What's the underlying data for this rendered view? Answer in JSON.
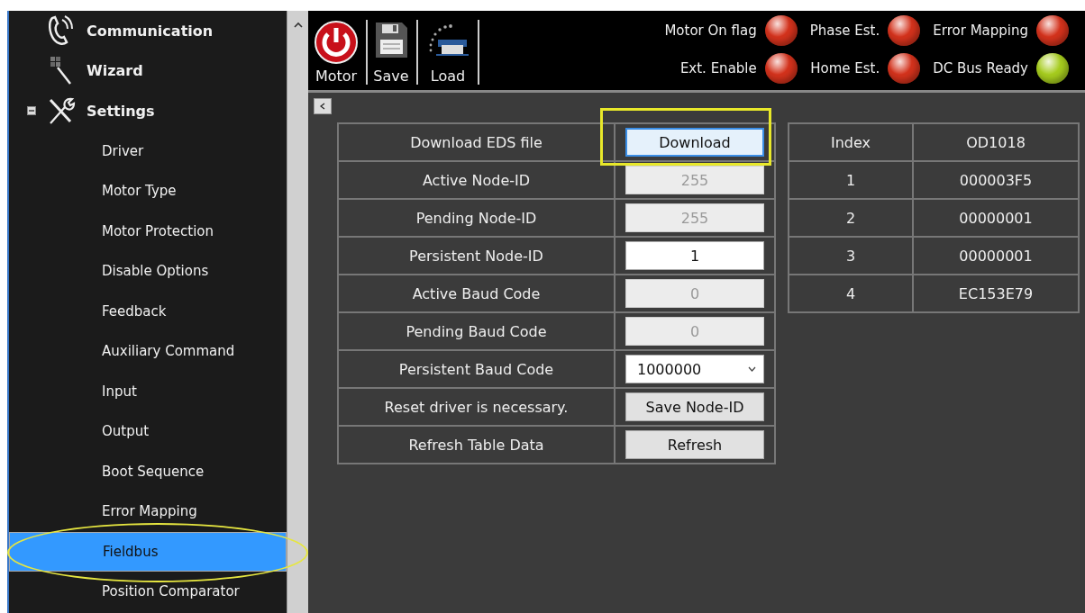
{
  "sidebar": {
    "items": [
      {
        "label": "Communication",
        "selected": false
      },
      {
        "label": "Wizard",
        "selected": false
      },
      {
        "label": "Settings",
        "selected": false,
        "expanded": true,
        "children": [
          {
            "label": "Driver",
            "selected": false
          },
          {
            "label": "Motor Type",
            "selected": false
          },
          {
            "label": "Motor Protection",
            "selected": false
          },
          {
            "label": "Disable Options",
            "selected": false
          },
          {
            "label": "Feedback",
            "selected": false
          },
          {
            "label": "Auxiliary Command",
            "selected": false
          },
          {
            "label": "Input",
            "selected": false
          },
          {
            "label": "Output",
            "selected": false
          },
          {
            "label": "Boot Sequence",
            "selected": false
          },
          {
            "label": "Error Mapping",
            "selected": false
          },
          {
            "label": "Fieldbus",
            "selected": true
          },
          {
            "label": "Position Comparator",
            "selected": false
          }
        ]
      }
    ]
  },
  "toolbar": {
    "buttons": [
      {
        "label": "Motor"
      },
      {
        "label": "Save"
      },
      {
        "label": "Load"
      }
    ],
    "indicators": [
      {
        "label": "Motor On flag",
        "color": "#d3321c"
      },
      {
        "label": "Ext. Enable",
        "color": "#d3321c"
      },
      {
        "label": "Phase Est.",
        "color": "#d3321c"
      },
      {
        "label": "Home Est.",
        "color": "#d3321c"
      },
      {
        "label": "Error Mapping",
        "color": "#d3321c"
      },
      {
        "label": "DC Bus Ready",
        "color": "#a6cc1e"
      }
    ]
  },
  "settings_table": {
    "rows": [
      {
        "label": "Download EDS file",
        "control": {
          "kind": "button",
          "text": "Download",
          "focused": true
        }
      },
      {
        "label": "Active Node-ID",
        "control": {
          "kind": "readonly",
          "text": "255"
        }
      },
      {
        "label": "Pending Node-ID",
        "control": {
          "kind": "readonly",
          "text": "255"
        }
      },
      {
        "label": "Persistent Node-ID",
        "control": {
          "kind": "input",
          "text": "1"
        }
      },
      {
        "label": "Active Baud Code",
        "control": {
          "kind": "readonly",
          "text": "0"
        }
      },
      {
        "label": "Pending Baud Code",
        "control": {
          "kind": "readonly",
          "text": "0"
        }
      },
      {
        "label": "Persistent Baud Code",
        "control": {
          "kind": "select",
          "text": "1000000"
        }
      },
      {
        "label": "Reset driver is necessary.",
        "control": {
          "kind": "button",
          "text": "Save Node-ID",
          "focused": false
        }
      },
      {
        "label": "Refresh Table Data",
        "control": {
          "kind": "button",
          "text": "Refresh",
          "focused": false
        }
      }
    ]
  },
  "od_table": {
    "columns": [
      "Index",
      "OD1018"
    ],
    "rows": [
      [
        "1",
        "000003F5"
      ],
      [
        "2",
        "00000001"
      ],
      [
        "3",
        "00000001"
      ],
      [
        "4",
        "EC153E79"
      ]
    ]
  }
}
